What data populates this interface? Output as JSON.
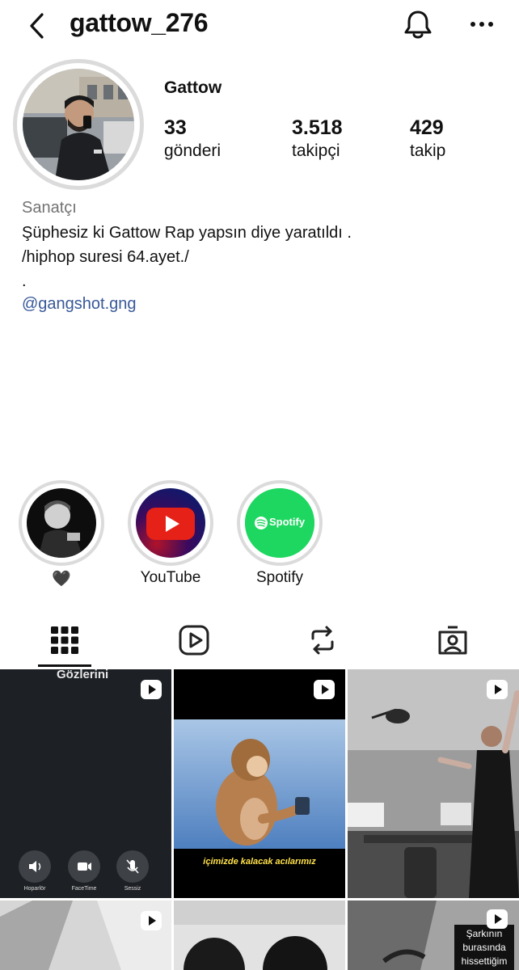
{
  "header": {
    "username": "gattow_276",
    "back_icon": "chevron-left-icon",
    "notification_icon": "bell-icon",
    "more_icon": "more-horizontal-icon"
  },
  "profile": {
    "display_name": "Gattow",
    "stats": [
      {
        "value": "33",
        "label": "gönderi"
      },
      {
        "value": "3.518",
        "label": "takipçi"
      },
      {
        "value": "429",
        "label": "takip"
      }
    ],
    "category": "Sanatçı",
    "bio_lines": [
      "Şüphesiz ki Gattow Rap yapsın diye yaratıldı .",
      "/hiphop suresi 64.ayet./",
      "."
    ],
    "link": "@gangshot.gng"
  },
  "highlights": [
    {
      "label": "🖤"
    },
    {
      "label": "YouTube"
    },
    {
      "label": "Spotify",
      "badge_text": "Spotify"
    }
  ],
  "tabs": [
    {
      "name": "posts",
      "icon": "grid-icon",
      "active": true
    },
    {
      "name": "reels",
      "icon": "reels-icon",
      "active": false
    },
    {
      "name": "reposts",
      "icon": "repost-icon",
      "active": false
    },
    {
      "name": "tagged",
      "icon": "tagged-person-icon",
      "active": false
    }
  ],
  "posts": [
    {
      "overlay_title": "Gözlerini",
      "call_buttons": [
        "Hoparlör",
        "FaceTime",
        "Sessiz"
      ]
    },
    {
      "caption": "içimizde kalacak acılarımız"
    },
    {},
    {},
    {},
    {
      "caption_lines": [
        "Şarkının",
        "burasında",
        "hissettiğim"
      ]
    }
  ],
  "colors": {
    "text": "#111111",
    "secondary_text": "#737373",
    "link": "#385898",
    "ring": "#dbdbdb",
    "youtube_red": "#e62117",
    "spotify_green": "#1ed760"
  }
}
